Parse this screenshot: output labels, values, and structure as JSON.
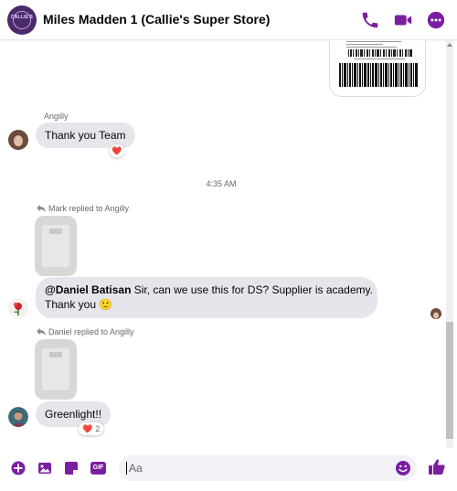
{
  "header": {
    "title": "Miles Madden 1 (Callie's Super Store)",
    "avatar_logo_text": "CALLIE'S",
    "accent_color": "#7a1fa2",
    "actions": [
      "phone-icon",
      "video-icon",
      "more-icon"
    ]
  },
  "messages": [
    {
      "sender": "Angilly",
      "text": "Thank you Team",
      "reaction": "❤️"
    },
    {
      "timestamp": "4:35 AM"
    },
    {
      "reply_label": "Mark replied to Angilly",
      "mention": "@Daniel Batisan",
      "text_line1": " Sir, can we use this for DS? Supplier is academy.",
      "text_line2": "Thank you",
      "emoji": "🙂"
    },
    {
      "reply_label": "Daniel replied to Angilly",
      "text": "Greenlight!!",
      "reaction": "❤️",
      "reaction_count": "2"
    }
  ],
  "composer": {
    "placeholder": "Aa",
    "icons": [
      "plus-icon",
      "photo-icon",
      "sticker-icon",
      "gif-icon",
      "emoji-icon",
      "like-icon"
    ],
    "gif_label": "GIF"
  }
}
